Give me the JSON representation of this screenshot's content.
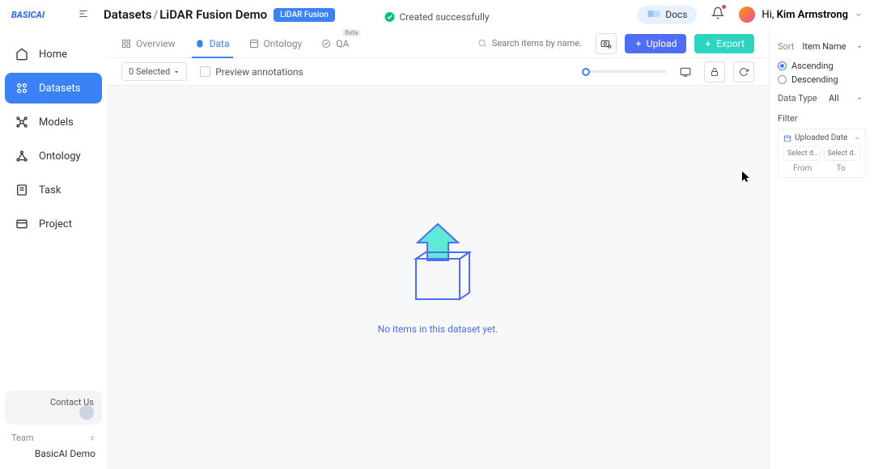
{
  "brand": "BASICAI",
  "breadcrumb": {
    "root": "Datasets",
    "current": "LiDAR Fusion Demo",
    "badge": "LiDAR Fusion"
  },
  "toast": "Created successfully",
  "header": {
    "docs_label": "Docs",
    "greeting_prefix": "Hi, ",
    "user_name": "Kim Armstrong"
  },
  "sidebar": {
    "items": [
      {
        "label": "Home"
      },
      {
        "label": "Datasets"
      },
      {
        "label": "Models"
      },
      {
        "label": "Ontology"
      },
      {
        "label": "Task"
      },
      {
        "label": "Project"
      }
    ],
    "contact_label": "Contact Us",
    "team_label": "Team",
    "team_name": "BasicAI Demo"
  },
  "tabs": {
    "items": [
      {
        "label": "Overview"
      },
      {
        "label": "Data"
      },
      {
        "label": "Ontology"
      },
      {
        "label": "QA",
        "badge": "Beta"
      }
    ],
    "search_placeholder": "Search items by name...",
    "upload_label": "Upload",
    "export_label": "Export"
  },
  "toolbar": {
    "selected_text": "0 Selected",
    "preview_label": "Preview annotations"
  },
  "empty": {
    "message": "No items in this dataset yet."
  },
  "right": {
    "sort_label": "Sort",
    "sort_value": "Item Name",
    "order_asc": "Ascending",
    "order_desc": "Descending",
    "dtype_label": "Data Type",
    "dtype_value": "All",
    "filter_label": "Filter",
    "uploaded_label": "Uploaded Date",
    "date_placeholder": "Select d...",
    "from_label": "From",
    "to_label": "To"
  }
}
